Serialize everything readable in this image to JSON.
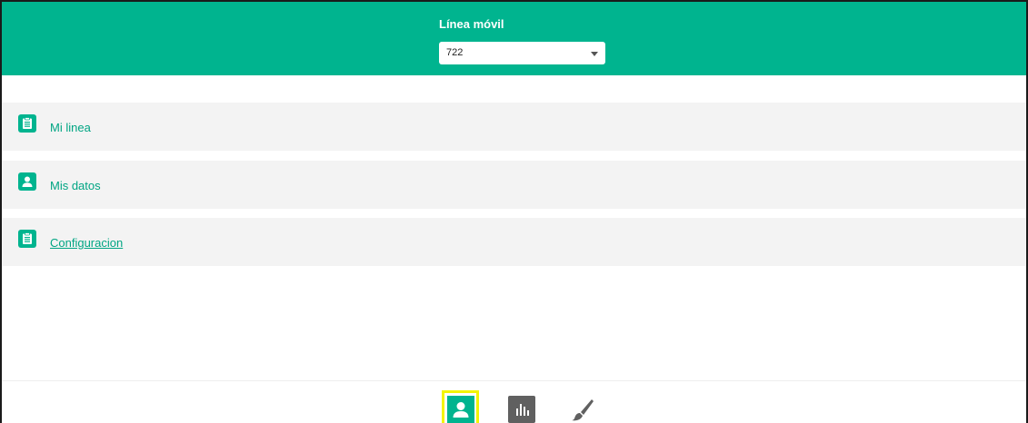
{
  "header": {
    "title": "Línea móvil",
    "selected_line": "722"
  },
  "menu": {
    "items": [
      {
        "label": "Mi linea",
        "icon": "clipboard-icon"
      },
      {
        "label": "Mis datos",
        "icon": "user-icon"
      },
      {
        "label": "Configuracion",
        "icon": "clipboard-icon"
      }
    ]
  },
  "bottom_nav": {
    "items": [
      {
        "icon": "user-icon",
        "active": true
      },
      {
        "icon": "bar-chart-icon",
        "active": false
      },
      {
        "icon": "brush-icon",
        "active": false
      }
    ]
  },
  "colors": {
    "accent": "#00b48f",
    "menu_bg": "#f3f3f3",
    "active_highlight": "#f3f500",
    "inactive_icon": "#606060"
  }
}
